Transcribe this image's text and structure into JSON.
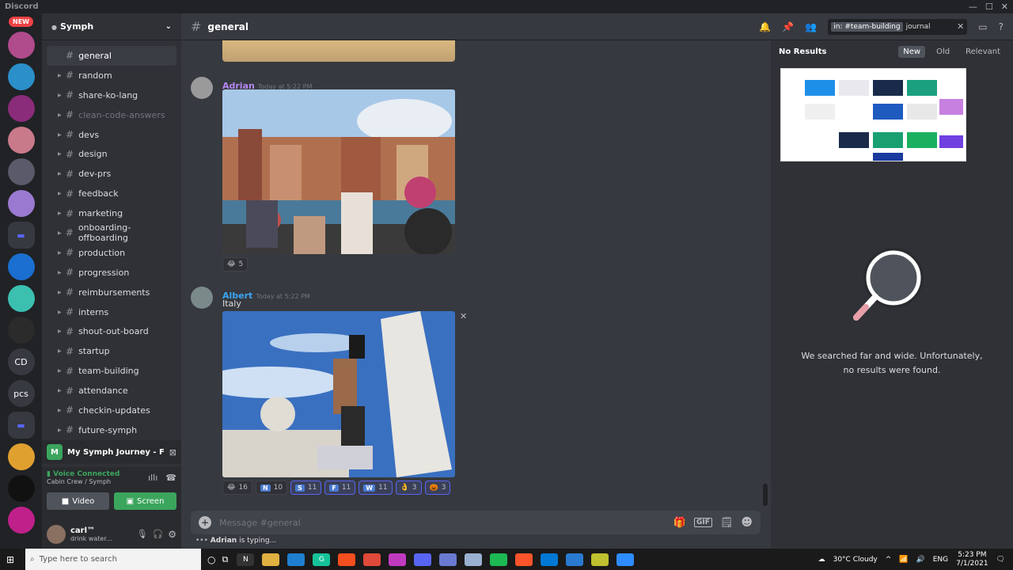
{
  "titlebar": {
    "brand": "Discord"
  },
  "server_rail": {
    "new_badge": "NEW",
    "items": [
      {
        "kind": "image",
        "color": "#b04b8c"
      },
      {
        "kind": "image",
        "color": "#2b8fc9"
      },
      {
        "kind": "image",
        "color": "#8a2c7a"
      },
      {
        "kind": "image",
        "color": "#c97a8a"
      },
      {
        "kind": "image",
        "color": "#5a5a6a"
      },
      {
        "kind": "image",
        "color": "#9a7ad0"
      },
      {
        "kind": "folder",
        "color": "#5865f2"
      },
      {
        "kind": "image",
        "color": "#1a6fd0"
      },
      {
        "kind": "image",
        "color": "#3bc0b0"
      },
      {
        "kind": "image",
        "color": "#2b2b2b"
      },
      {
        "kind": "text",
        "label": "CD",
        "color": "#36393f"
      },
      {
        "kind": "text",
        "label": "pcs",
        "color": "#36393f"
      },
      {
        "kind": "folder",
        "color": "#5865f2"
      },
      {
        "kind": "image",
        "color": "#e0a030"
      },
      {
        "kind": "image",
        "color": "#111111"
      },
      {
        "kind": "image",
        "color": "#c0208a"
      }
    ]
  },
  "server": {
    "name": "Symph"
  },
  "channels": [
    {
      "name": "general",
      "active": true,
      "arrow": false
    },
    {
      "name": "random",
      "arrow": true
    },
    {
      "name": "share-ko-lang",
      "arrow": true
    },
    {
      "name": "clean-code-answers",
      "muted": true,
      "arrow": true
    },
    {
      "name": "devs",
      "arrow": true
    },
    {
      "name": "design",
      "arrow": true
    },
    {
      "name": "dev-prs",
      "arrow": true
    },
    {
      "name": "feedback",
      "arrow": true
    },
    {
      "name": "marketing",
      "arrow": true
    },
    {
      "name": "onboarding-offboarding",
      "arrow": true
    },
    {
      "name": "production",
      "arrow": true
    },
    {
      "name": "progression",
      "arrow": true
    },
    {
      "name": "reimbursements",
      "arrow": true
    },
    {
      "name": "interns",
      "arrow": true
    },
    {
      "name": "shout-out-board",
      "arrow": true
    },
    {
      "name": "startup",
      "arrow": true
    },
    {
      "name": "team-building",
      "arrow": true
    },
    {
      "name": "attendance",
      "arrow": true
    },
    {
      "name": "checkin-updates",
      "arrow": true
    },
    {
      "name": "future-symph",
      "arrow": true
    }
  ],
  "stage": {
    "badge": "M",
    "title": "My Symph Journey - Fi..."
  },
  "voice": {
    "status": "Voice Connected",
    "location": "Cabin Crew / Symph",
    "video_label": "Video",
    "screen_label": "Screen"
  },
  "user": {
    "name": "carl™",
    "status": "drink water..."
  },
  "header": {
    "channel": "general"
  },
  "search": {
    "chip": "in: #team-building",
    "query": "journal"
  },
  "messages": [
    {
      "author": "Adrian",
      "time": "Today at 5:22 PM",
      "color": "#b586f2",
      "reactions": [
        {
          "emoji": "😂",
          "count": "5"
        }
      ]
    },
    {
      "author": "Albert",
      "time": "Today at 5:22 PM",
      "color": "#3aa6f5",
      "text": "Italy",
      "reactions": [
        {
          "emoji": "😂",
          "count": "16"
        },
        {
          "emoji": "N",
          "count": "10",
          "color": "#4a7ad0"
        },
        {
          "emoji": "S",
          "count": "11",
          "color": "#4a7ad0",
          "me": true
        },
        {
          "emoji": "F",
          "count": "11",
          "color": "#4a7ad0",
          "me": true
        },
        {
          "emoji": "W",
          "count": "11",
          "color": "#4a7ad0",
          "me": true
        },
        {
          "emoji": "👌",
          "count": "3",
          "me": true
        },
        {
          "emoji": "🎃",
          "count": "3",
          "me": true
        }
      ]
    }
  ],
  "composer": {
    "placeholder": "Message #general"
  },
  "typing": {
    "who": "Adrian",
    "suffix": "is typing..."
  },
  "results": {
    "title": "No Results",
    "tabs": [
      {
        "label": "New",
        "active": true
      },
      {
        "label": "Old"
      },
      {
        "label": "Relevant"
      }
    ],
    "empty_line1": "We searched far and wide. Unfortunately,",
    "empty_line2": "no results were found."
  },
  "taskbar": {
    "search_placeholder": "Type here to search",
    "weather": "30°C  Cloudy",
    "lang": "ENG",
    "time": "5:23 PM",
    "date": "7/1/2021",
    "apps": [
      {
        "label": "N",
        "color": "#333333"
      },
      {
        "label": "",
        "color": "#e0b040"
      },
      {
        "label": "",
        "color": "#1f7fd0"
      },
      {
        "label": "G",
        "color": "#15c39a"
      },
      {
        "label": "",
        "color": "#f24e1e"
      },
      {
        "label": "",
        "color": "#e04a3a"
      },
      {
        "label": "",
        "color": "#c03ac0"
      },
      {
        "label": "",
        "color": "#5865f2"
      },
      {
        "label": "",
        "color": "#6a7ad0"
      },
      {
        "label": "",
        "color": "#9ab0d0"
      },
      {
        "label": "",
        "color": "#1db954"
      },
      {
        "label": "",
        "color": "#fb542b"
      },
      {
        "label": "",
        "color": "#0078d4"
      },
      {
        "label": "",
        "color": "#2a7ad0"
      },
      {
        "label": "",
        "color": "#c0c030"
      },
      {
        "label": "",
        "color": "#2d8cff"
      }
    ]
  }
}
